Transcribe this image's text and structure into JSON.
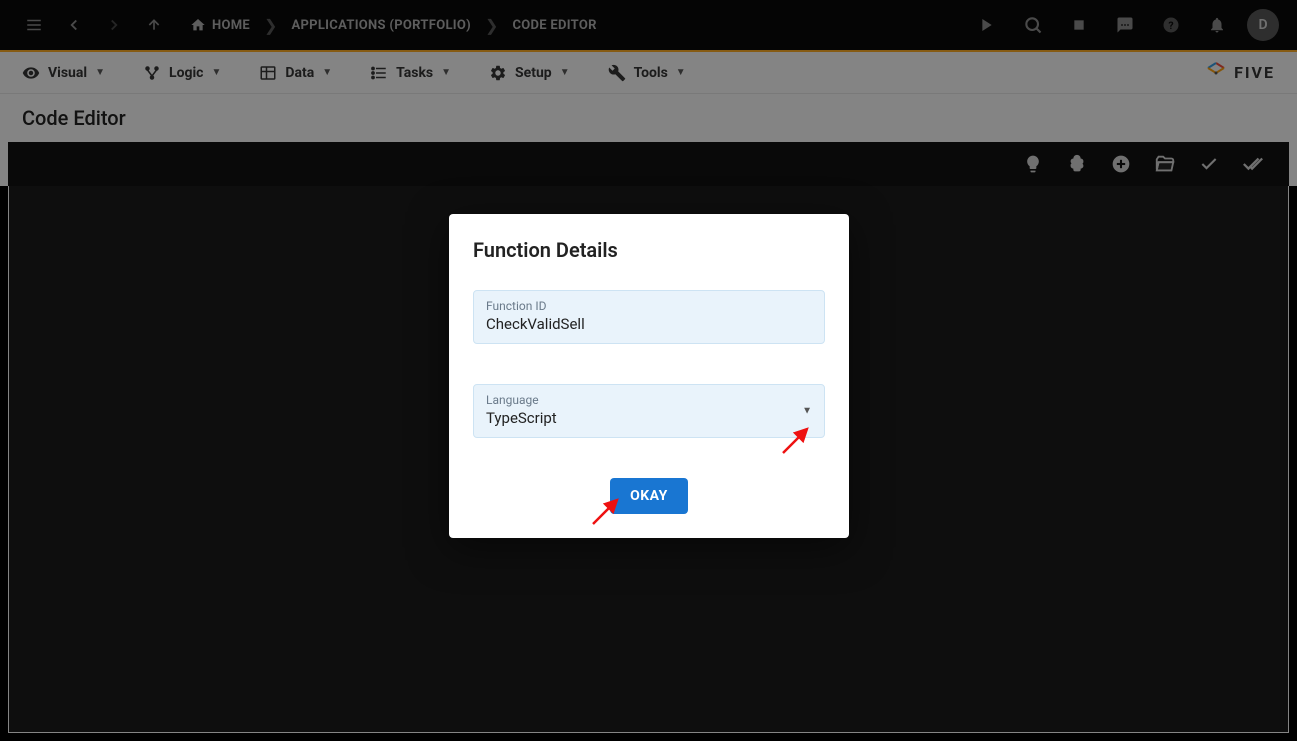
{
  "topbar": {
    "breadcrumbs": [
      {
        "label": "HOME",
        "icon": "home"
      },
      {
        "label": "APPLICATIONS (PORTFOLIO)"
      },
      {
        "label": "CODE EDITOR"
      }
    ],
    "avatar_letter": "D"
  },
  "menubar": {
    "items": [
      {
        "label": "Visual",
        "icon": "eye"
      },
      {
        "label": "Logic",
        "icon": "branch"
      },
      {
        "label": "Data",
        "icon": "table"
      },
      {
        "label": "Tasks",
        "icon": "list"
      },
      {
        "label": "Setup",
        "icon": "gear"
      },
      {
        "label": "Tools",
        "icon": "wrench"
      }
    ],
    "logo_text": "FIVE"
  },
  "page_title": "Code Editor",
  "dialog": {
    "title": "Function Details",
    "function_id_label": "Function ID",
    "function_id_value": "CheckValidSell",
    "language_label": "Language",
    "language_value": "TypeScript",
    "okay_label": "OKAY"
  }
}
